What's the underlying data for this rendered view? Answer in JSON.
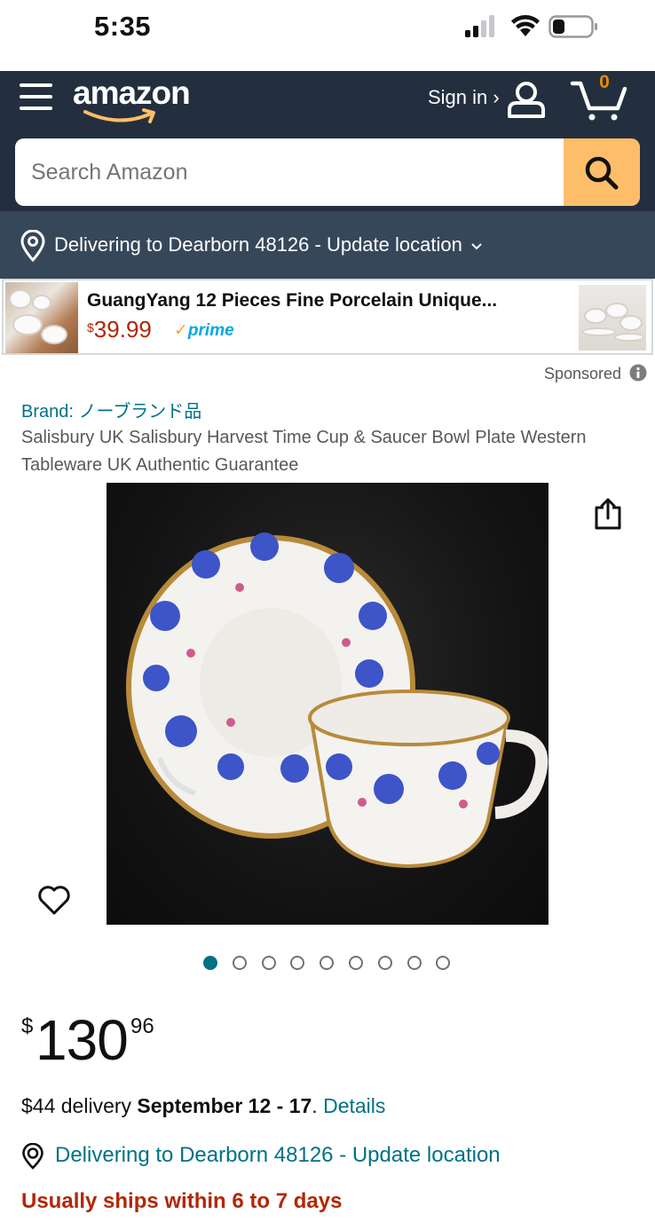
{
  "status_bar": {
    "time": "5:35",
    "signal_bars": 2,
    "battery_level": 0.3
  },
  "header": {
    "logo_text": "amazon",
    "signin_label": "Sign in ›",
    "cart_count": "0",
    "colors": {
      "bg": "#232f3e",
      "accent": "#febd69",
      "cart_count": "#f08804"
    }
  },
  "search": {
    "placeholder": "Search Amazon"
  },
  "delivery_bar": {
    "text": "Delivering to Dearborn 48126 - Update location",
    "bg_color": "#37475a"
  },
  "sponsored_banner": {
    "title": "GuangYang 12 Pieces Fine Porcelain Unique...",
    "price_symbol": "$",
    "price": "39.99",
    "prime_label": "prime",
    "prime_check": "✓"
  },
  "sponsored_label": "Sponsored",
  "product": {
    "brand": "Brand: ノーブランド品",
    "title": "Salisbury UK Salisbury Harvest Time Cup & Saucer Bowl Plate Western Tableware UK Authentic Guarantee",
    "image_count": 9,
    "active_image": 1,
    "price_symbol": "$",
    "price_whole": "130",
    "price_fraction": "96"
  },
  "delivery": {
    "cost_text": "$44 delivery ",
    "dates": "September 12 - 17",
    "after_dates": ". ",
    "details_link": "Details"
  },
  "location_line": "Delivering to Dearborn 48126 - Update location",
  "shipping_note": "Usually ships within 6 to 7 days"
}
